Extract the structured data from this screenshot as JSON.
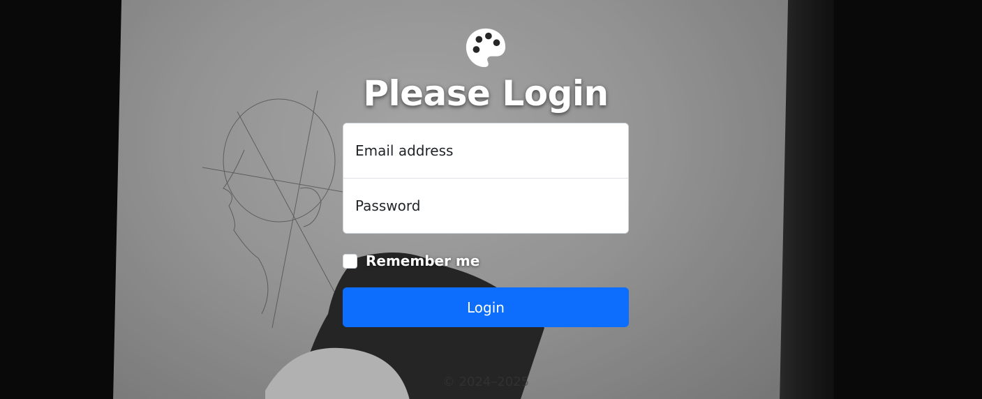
{
  "login": {
    "title": "Please Login",
    "email_placeholder": "Email address",
    "password_placeholder": "Password",
    "remember_label": "Remember me",
    "submit_label": "Login"
  },
  "footer": {
    "text": "© 2024–2025"
  },
  "colors": {
    "accent": "#0d6efd",
    "title": "#ffffff"
  },
  "icons": {
    "logo": "palette-icon"
  }
}
